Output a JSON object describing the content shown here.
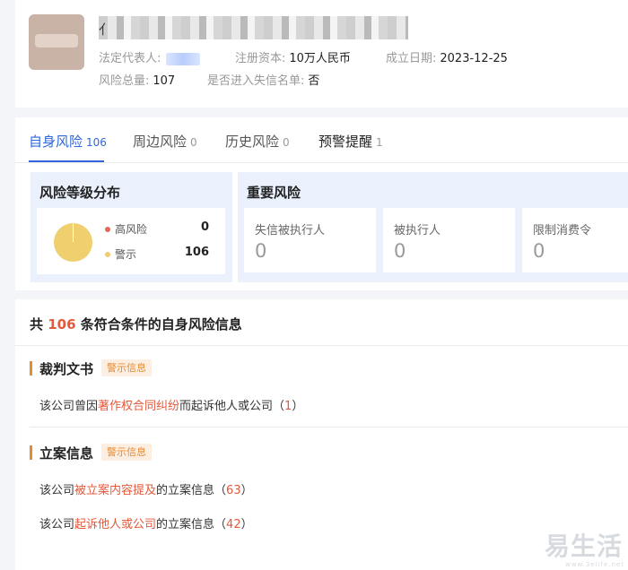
{
  "company": {
    "name_visible": "亻",
    "legal_rep_label": "法定代表人:",
    "capital_label": "注册资本:",
    "capital_value": "10万人民币",
    "founded_label": "成立日期:",
    "founded_value": "2023-12-25",
    "risk_total_label": "风险总量:",
    "risk_total_value": "107",
    "blacklist_label": "是否进入失信名单:",
    "blacklist_value": "否"
  },
  "tabs": [
    {
      "label": "自身风险",
      "count": "106"
    },
    {
      "label": "周边风险",
      "count": "0"
    },
    {
      "label": "历史风险",
      "count": "0"
    },
    {
      "label": "预警提醒",
      "count": "1"
    }
  ],
  "risk_level": {
    "title": "风险等级分布",
    "legend": [
      {
        "label": "高风险",
        "value": "0",
        "color": "#e26a58"
      },
      {
        "label": "警示",
        "value": "106",
        "color": "#f0cf6f"
      }
    ]
  },
  "major_risk": {
    "title": "重要风险",
    "items": [
      {
        "label": "失信被执行人",
        "value": "0"
      },
      {
        "label": "被执行人",
        "value": "0"
      },
      {
        "label": "限制消费令",
        "value": "0"
      }
    ]
  },
  "results": {
    "prefix": "共",
    "count": "106",
    "suffix": "条符合条件的自身风险信息",
    "sections": [
      {
        "title": "裁判文书",
        "tag": "警示信息",
        "rows": [
          {
            "pre": "该公司曾因",
            "hl": "著作权合同纠纷",
            "post": "而起诉他人或公司（",
            "n": "1",
            "end": "）"
          }
        ]
      },
      {
        "title": "立案信息",
        "tag": "警示信息",
        "rows": [
          {
            "pre": "该公司",
            "hl": "被立案内容提及",
            "post": "的立案信息（",
            "n": "63",
            "end": "）"
          },
          {
            "pre": "该公司",
            "hl": "起诉他人或公司",
            "post": "的立案信息（",
            "n": "42",
            "end": "）"
          }
        ]
      }
    ]
  },
  "watermark": {
    "text": "易生活",
    "sub": "www.3elife.net"
  },
  "colors": {
    "accent": "#2f66db",
    "warn": "#e98a2e",
    "danger": "#e5583b"
  }
}
